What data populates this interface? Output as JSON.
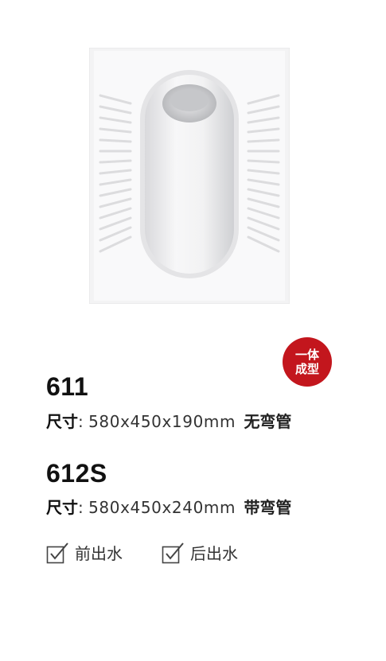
{
  "badge": {
    "line1": "一体",
    "line2": "成型"
  },
  "products": [
    {
      "model": "611",
      "size_label": "尺寸",
      "separator": ":",
      "size_value": "580x450x190mm",
      "note": "无弯管"
    },
    {
      "model": "612S",
      "size_label": "尺寸",
      "separator": ":",
      "size_value": "580x450x240mm",
      "note": "带弯管"
    }
  ],
  "features": [
    {
      "label": "前出水",
      "icon": "checkbox-check-icon"
    },
    {
      "label": "后出水",
      "icon": "checkbox-check-icon"
    }
  ],
  "colors": {
    "badge": "#c3161d",
    "text": "#333333"
  }
}
